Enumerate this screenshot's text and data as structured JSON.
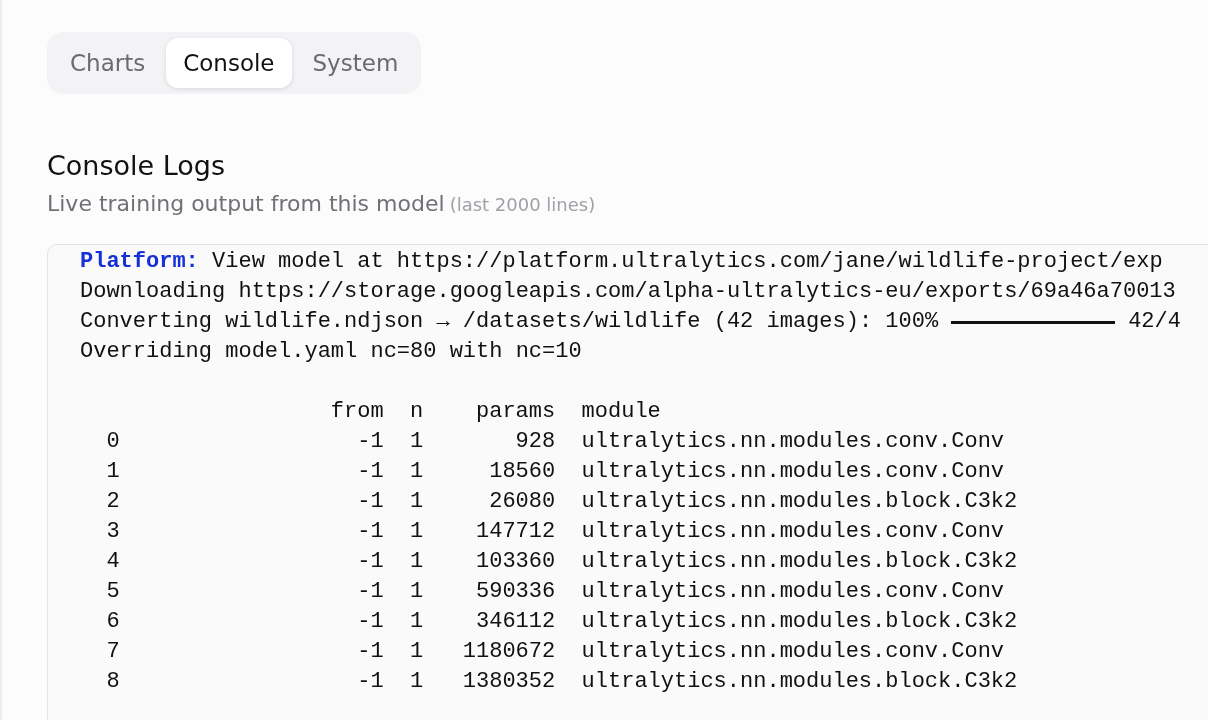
{
  "tabs": [
    {
      "label": "Charts",
      "selected": false
    },
    {
      "label": "Console",
      "selected": true
    },
    {
      "label": "System",
      "selected": false
    }
  ],
  "section": {
    "title": "Console Logs",
    "subtitle": "Live training output from this model",
    "note": "(last 2000 lines)"
  },
  "console": {
    "lines": [
      {
        "kind": "tagged",
        "tag": "Platform:",
        "text": "View model at https://platform.ultralytics.com/jane/wildlife-project/exp"
      },
      {
        "kind": "text",
        "text": "Downloading https://storage.googleapis.com/alpha-ultralytics-eu/exports/69a46a70013"
      },
      {
        "kind": "progress",
        "text": "Converting wildlife.ndjson → /datasets/wildlife (42 images): 100%",
        "level": 1,
        "after": "42/4"
      },
      {
        "kind": "text",
        "text": "Overriding model.yaml nc=80 with nc=10"
      },
      {
        "kind": "blank"
      }
    ],
    "table": {
      "columns": [
        "",
        "from",
        "n",
        "params",
        "module"
      ],
      "rows": [
        [
          "0",
          "-1",
          "1",
          "928",
          "ultralytics.nn.modules.conv.Conv"
        ],
        [
          "1",
          "-1",
          "1",
          "18560",
          "ultralytics.nn.modules.conv.Conv"
        ],
        [
          "2",
          "-1",
          "1",
          "26080",
          "ultralytics.nn.modules.block.C3k2"
        ],
        [
          "3",
          "-1",
          "1",
          "147712",
          "ultralytics.nn.modules.conv.Conv"
        ],
        [
          "4",
          "-1",
          "1",
          "103360",
          "ultralytics.nn.modules.block.C3k2"
        ],
        [
          "5",
          "-1",
          "1",
          "590336",
          "ultralytics.nn.modules.conv.Conv"
        ],
        [
          "6",
          "-1",
          "1",
          "346112",
          "ultralytics.nn.modules.block.C3k2"
        ],
        [
          "7",
          "-1",
          "1",
          "1180672",
          "ultralytics.nn.modules.conv.Conv"
        ],
        [
          "8",
          "-1",
          "1",
          "1380352",
          "ultralytics.nn.modules.block.C3k2"
        ]
      ]
    }
  }
}
